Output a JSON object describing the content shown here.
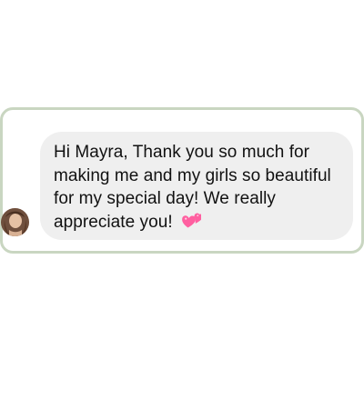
{
  "conversation": {
    "message": {
      "text": "Hi Mayra, Thank you so much for making me and my girls so beautiful for my special day! We really appreciate you!",
      "emoji": "two-hearts-icon"
    }
  },
  "theme": {
    "frame_border": "#c9d6c1",
    "bubble_background": "#efefef",
    "text_color": "#111111",
    "heart_color": "#ff5fa0"
  }
}
